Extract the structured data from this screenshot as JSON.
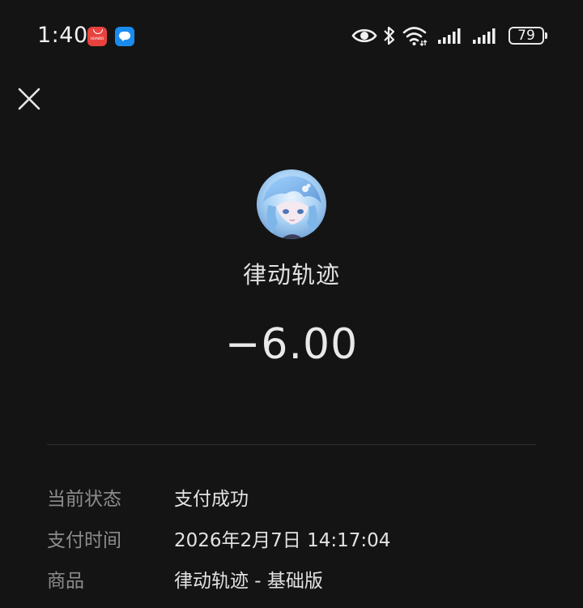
{
  "status_bar": {
    "time": "1:40",
    "battery": "79",
    "app_badges": [
      "huawei-appgallery-icon",
      "message-icon"
    ],
    "icons": [
      "eye-icon",
      "bluetooth-icon",
      "wifi-icon",
      "signal-icon",
      "signal-icon"
    ],
    "huawei_badge_text": "HUAWEI"
  },
  "header": {
    "close_icon": "close-icon"
  },
  "merchant": {
    "name": "律动轨迹",
    "avatar": "anime-avatar"
  },
  "payment": {
    "amount": "−6.00"
  },
  "details": [
    {
      "label": "当前状态",
      "value": "支付成功"
    },
    {
      "label": "支付时间",
      "value": "2026年2月7日 14:17:04"
    },
    {
      "label": "商品",
      "value": "律动轨迹 - 基础版"
    }
  ],
  "colors": {
    "background": "#141414",
    "text_primary": "#e6e6e6",
    "text_secondary": "#8c8c8c",
    "divider": "#2f2f2f"
  }
}
